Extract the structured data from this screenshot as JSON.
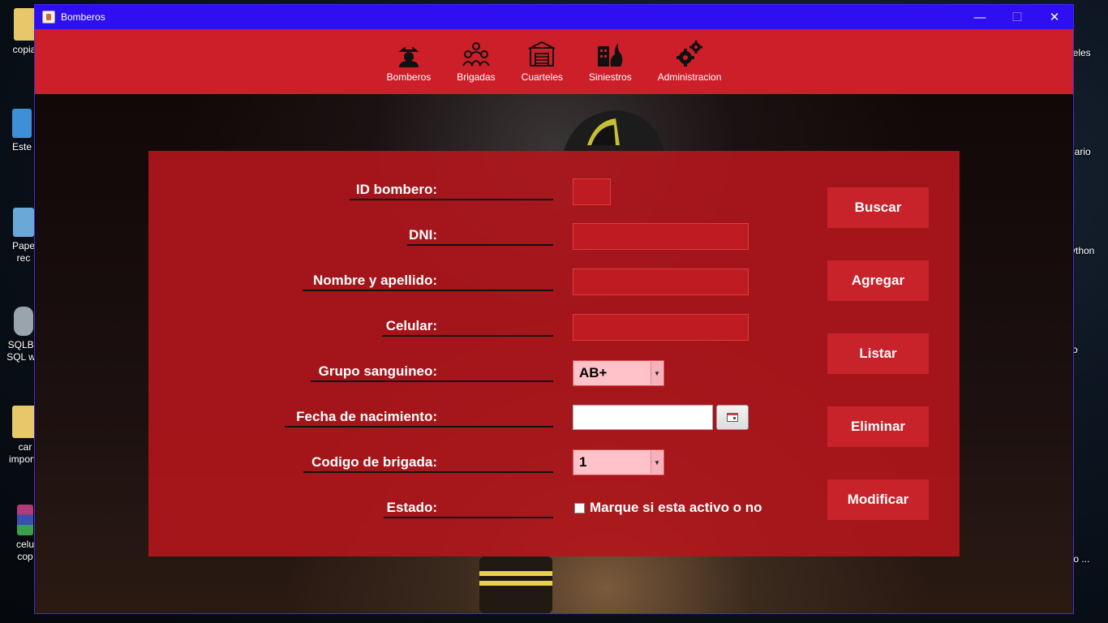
{
  "desktop": {
    "left_icons": [
      {
        "label": "copiafi",
        "color": "#e8c66a"
      },
      {
        "label": "Este",
        "color": "#3d8fd6"
      },
      {
        "label": "Pape\nrec",
        "color": "#6aa8d8"
      },
      {
        "label": "SQLBo\nSQL wit",
        "color": "#9aa4ad"
      },
      {
        "label": "car\nimporta",
        "color": "#e8c66a"
      },
      {
        "label": "celu\ncop",
        "color": "#b03a7a"
      }
    ],
    "right_icons": [
      {
        "label": "ixeles"
      },
      {
        "label": "dario"
      },
      {
        "label": "ython"
      },
      {
        "label": "o"
      },
      {
        "label": "to ..."
      }
    ]
  },
  "window": {
    "title": "Bomberos",
    "controls": {
      "minimize": "—",
      "maximize": "☐",
      "close": "✕"
    }
  },
  "menu": [
    {
      "label": "Bomberos",
      "icon": "firefighter-icon"
    },
    {
      "label": "Brigadas",
      "icon": "brigade-icon"
    },
    {
      "label": "Cuarteles",
      "icon": "fire-station-icon"
    },
    {
      "label": "Siniestros",
      "icon": "burning-building-icon"
    },
    {
      "label": "Administracion",
      "icon": "gears-icon"
    }
  ],
  "form": {
    "labels": {
      "id": "ID bombero:",
      "dni": "DNI:",
      "nombre": "Nombre y apellido:",
      "celular": "Celular:",
      "grupo": "Grupo sanguineo:",
      "fecha": "Fecha de nacimiento:",
      "codigo": "Codigo de brigada:",
      "estado": "Estado:"
    },
    "values": {
      "id": "",
      "dni": "",
      "nombre": "",
      "celular": "",
      "grupo": "AB+",
      "fecha": "",
      "codigo": "1",
      "estado_checked": false
    },
    "checkbox_label": "Marque si esta activo o no"
  },
  "actions": {
    "buscar": "Buscar",
    "agregar": "Agregar",
    "listar": "Listar",
    "eliminar": "Eliminar",
    "modificar": "Modificar"
  },
  "colors": {
    "titlebar": "#2f0ff2",
    "menubar": "#cd1f29",
    "panel": "#b2161c",
    "button": "#c8222b"
  }
}
